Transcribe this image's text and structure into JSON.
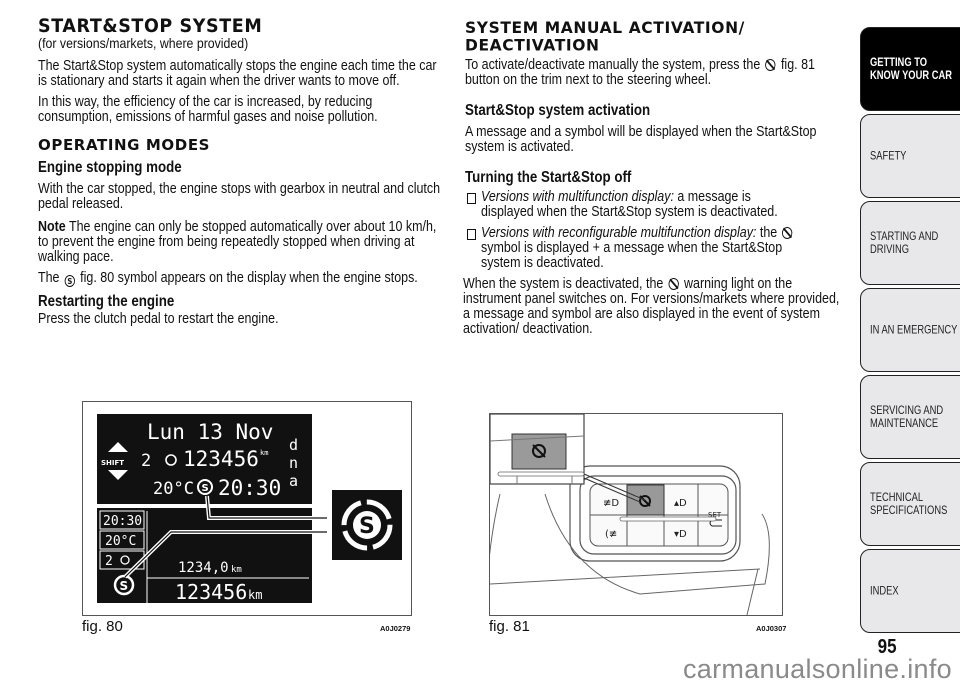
{
  "left": {
    "title": "START&STOP SYSTEM",
    "subtitle": "(for versions/markets, where provided)",
    "intro_1": "The Start&Stop system automatically stops the engine each time the car is stationary and starts it again when the driver wants to move off.",
    "intro_2": "In this way, the efficiency of the car is increased, by reducing consumption, emissions of harmful gases and noise pollution.",
    "section_title": "OPERATING MODES",
    "engine_stopping": {
      "heading": "Engine stopping mode",
      "text": "With the car stopped, the engine stops with gearbox in neutral and clutch pedal released.",
      "note_label": "Note",
      "note_text": " The engine can only be stopped automatically over about 10 km/h, to prevent the engine from being repeatedly stopped when driving at walking pace.",
      "symbol_before": "The ",
      "symbol_after": " fig. 80 symbol appears on the display when the engine stops."
    },
    "restarting": {
      "heading": "Restarting the engine",
      "text": "Press the clutch pedal to restart the engine."
    }
  },
  "right": {
    "title_line1": "SYSTEM MANUAL ACTIVATION/",
    "title_line2": "DEACTIVATION",
    "intro_before": "To activate/deactivate manually the system, press the ",
    "intro_after": " fig. 81 button on the trim next to the steering wheel.",
    "activation": {
      "heading": "Start&Stop system activation",
      "text": "A message and a symbol will be displayed when the Start&Stop system is activated."
    },
    "turning_off": {
      "heading": "Turning the Start&Stop off",
      "bullet1_italic": "Versions with multifunction display:",
      "bullet1_text": " a message is displayed when the Start&Stop system is deactivated.",
      "bullet2_italic": "Versions with reconfigurable multifunction display:",
      "bullet2_before": " the ",
      "bullet2_after": " symbol is displayed + a message when the Start&Stop system is deactivated.",
      "para_before": "When the system is deactivated, the ",
      "para_after": " warning light on the instrument panel switches on. For versions/markets where provided, a message and symbol are also displayed in the event of system activation/ deactivation."
    }
  },
  "fig80": {
    "caption": "fig. 80",
    "code": "A0J0279",
    "display": {
      "date": "Lun 13 Nov",
      "odometer": "123456",
      "unit_small": "km",
      "temp": "20°C",
      "time": "20:30",
      "shift_label": "SHIFT",
      "gear_letters": [
        "d",
        "n",
        "a"
      ],
      "side_time": "20:30",
      "side_temp": "20°C",
      "side_lights": "2",
      "trip": "1234,0",
      "trip_unit": "km",
      "total": "123456",
      "total_unit": "km",
      "symbol": "S"
    }
  },
  "fig81": {
    "caption": "fig. 81",
    "code": "A0J0307",
    "set_label": "SET"
  },
  "sidebar": {
    "tabs": [
      {
        "label_line1": "GETTING TO",
        "label_line2": "KNOW YOUR CAR",
        "active": true
      },
      {
        "label_line1": "SAFETY",
        "label_line2": ""
      },
      {
        "label_line1": "STARTING AND",
        "label_line2": "DRIVING"
      },
      {
        "label_line1": "IN AN EMERGENCY",
        "label_line2": ""
      },
      {
        "label_line1": "SERVICING AND",
        "label_line2": "MAINTENANCE"
      },
      {
        "label_line1": "TECHNICAL",
        "label_line2": "SPECIFICATIONS"
      },
      {
        "label_line1": "INDEX",
        "label_line2": ""
      }
    ]
  },
  "page_number": "95",
  "watermark": "carmanualsonline.info"
}
